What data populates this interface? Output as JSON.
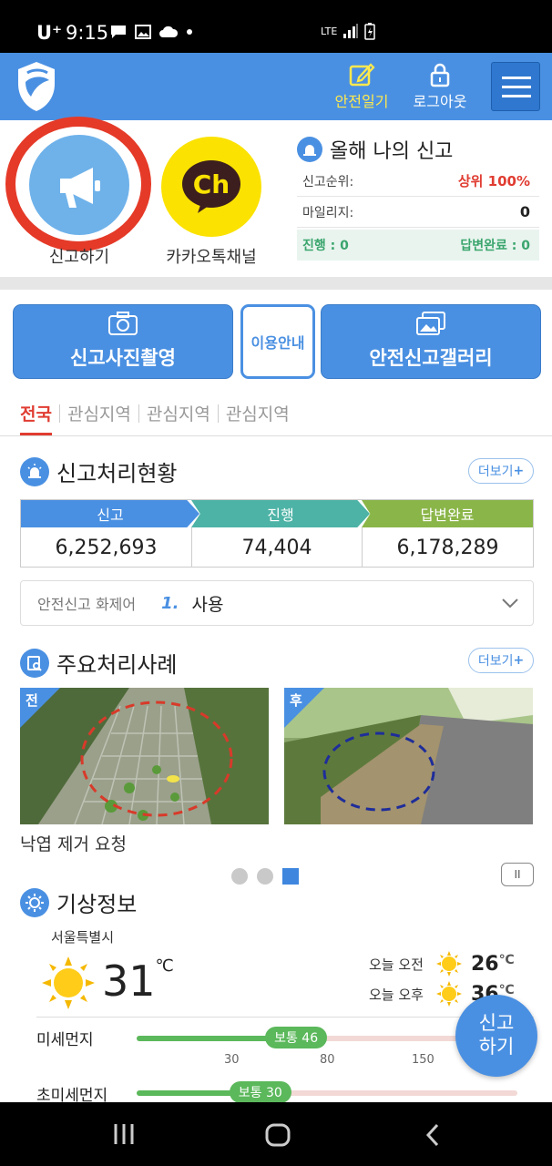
{
  "status_bar": {
    "carrier": "U⁺",
    "time": "9:15",
    "network": "LTE"
  },
  "header": {
    "diary_label": "안전일기",
    "logout_label": "로그아웃",
    "icons": [
      "shield-logo-icon",
      "pencil-note-icon",
      "lock-icon",
      "menu-icon"
    ]
  },
  "quick": {
    "report_label": "신고하기",
    "kakao_label": "카카오톡채널",
    "kakao_logo_text": "Ch"
  },
  "my_reports": {
    "title": "올해 나의 신고",
    "rank_label": "신고순위:",
    "rank_value": "상위 100%",
    "mileage_label": "마일리지:",
    "mileage_value": "0",
    "progress_label": "진행 : 0",
    "done_label": "답변완료 : 0"
  },
  "actions": {
    "photo_label": "신고사진촬영",
    "guide_label": "이용안내",
    "gallery_label": "안전신고갤러리"
  },
  "region_tabs": [
    "전국",
    "관심지역",
    "관심지역",
    "관심지역"
  ],
  "status_section": {
    "title": "신고처리현황",
    "more_label": "더보기",
    "headers": [
      "신고",
      "진행",
      "답변완료"
    ],
    "values": [
      "6,252,693",
      "74,404",
      "6,178,289"
    ],
    "colors": [
      "#4a90e2",
      "#4db3a6",
      "#8ab548"
    ]
  },
  "keyword": {
    "label": "안전신고 화제어",
    "rank": "1.",
    "word": "사용"
  },
  "cases": {
    "title": "주요처리사례",
    "more_label": "더보기",
    "before_tag": "전",
    "after_tag": "후",
    "caption": "낙엽 제거 요청",
    "pause_label": "II"
  },
  "weather": {
    "title": "기상정보",
    "city": "서울특별시",
    "temp": "31",
    "unit": "℃",
    "am_label": "오늘 오전",
    "am_temp": "26",
    "pm_label": "오늘 오후",
    "pm_temp": "36",
    "pm10": {
      "label": "미세먼지",
      "badge": "보통 46",
      "level": 46
    },
    "pm25": {
      "label": "초미세먼지",
      "badge": "보통 30",
      "level": 30
    },
    "ticks": [
      "30",
      "80",
      "150"
    ]
  },
  "fab_label_1": "신고",
  "fab_label_2": "하기"
}
